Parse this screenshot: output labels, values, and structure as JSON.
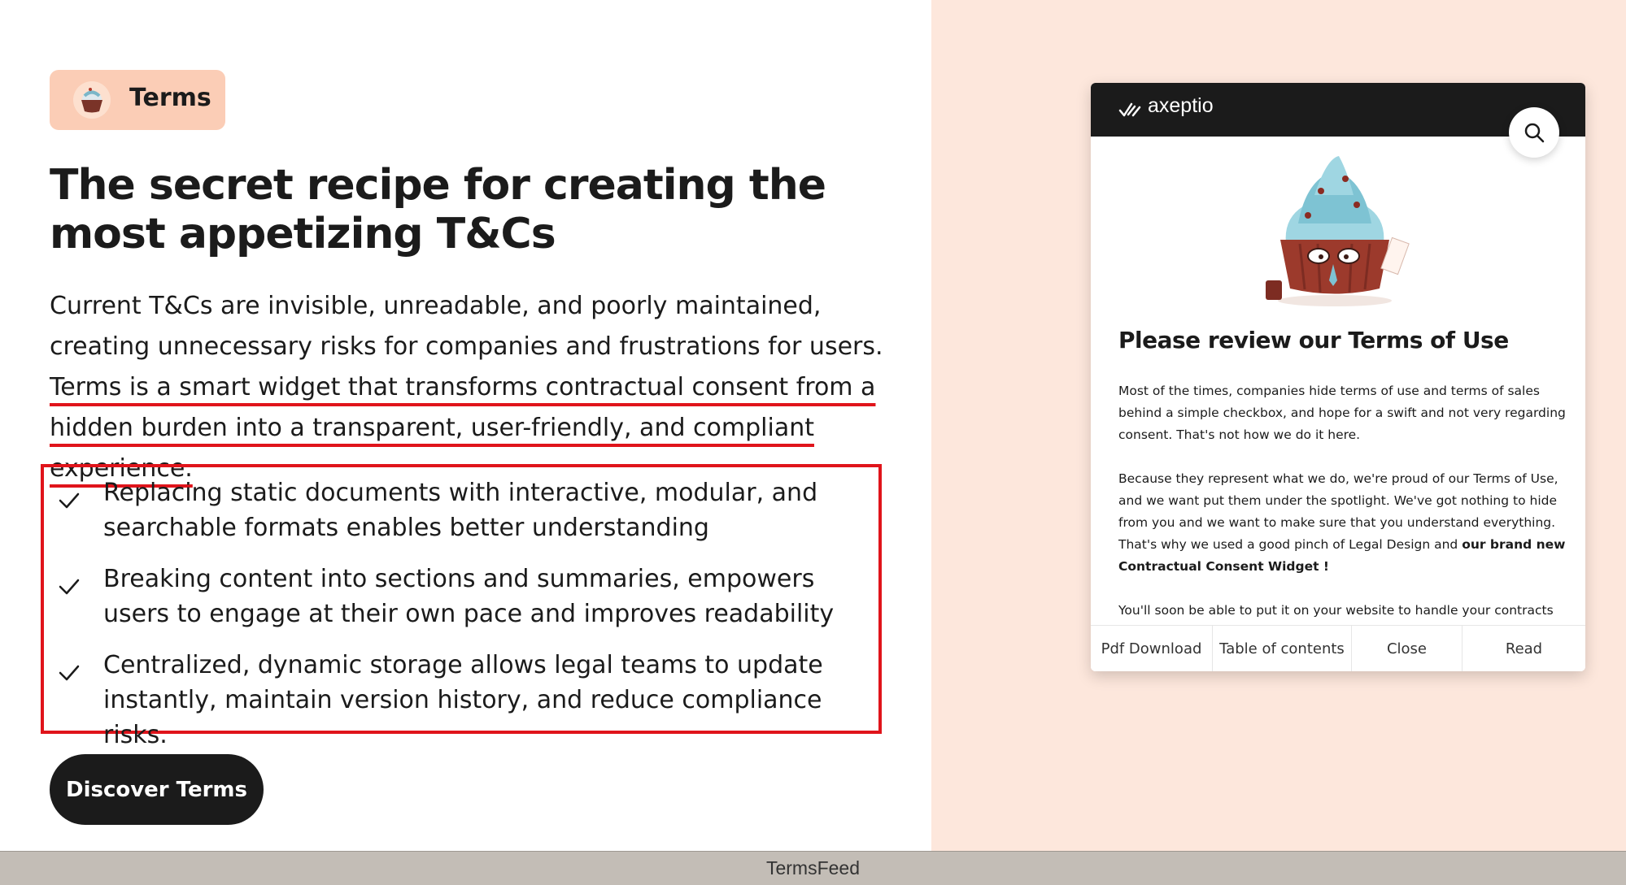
{
  "badge": {
    "label": "Terms",
    "icon": "cupcake-icon"
  },
  "hero": {
    "headline": "The secret recipe for creating the most appetizing T&Cs",
    "intro_plain": "Current T&Cs are invisible, unreadable, and poorly maintained, creating unnecessary risks for companies and frustrations for users.",
    "intro_highlight": " Terms is a smart widget that transforms contractual consent from a hidden burden into a transparent, user-friendly, and compliant experience. "
  },
  "features": [
    {
      "icon": "checkmark-icon",
      "text": "Replacing static documents with interactive, modular, and searchable formats enables better understanding"
    },
    {
      "icon": "checkmark-icon",
      "text": "Breaking content into sections and summaries, empowers users to engage at their own pace and improves readability"
    },
    {
      "icon": "checkmark-icon",
      "text": "Centralized, dynamic storage allows legal teams to update instantly, maintain version history, and reduce compliance risks."
    }
  ],
  "cta": {
    "label": "Discover Terms"
  },
  "widget": {
    "brand": "axeptio",
    "search_icon": "search-icon",
    "title": "Please review our Terms of Use",
    "paragraph1": "Most of the times, companies hide terms of use and terms of sales behind a simple checkbox, and hope for a swift and not very regarding consent. That's not how we do it here.",
    "paragraph2_plain": "Because they represent what we do, we're proud of our Terms of Use, and we want put them under the spotlight. We've got nothing to hide from you and we want to make sure that you understand everything. That's why we used a good pinch of Legal Design and ",
    "paragraph2_bold": "our brand new Contractual Consent Widget !",
    "paragraph3": "You'll soon be able to put it on your website to handle your contracts or",
    "actions": [
      "Pdf Download",
      "Table of contents",
      "Close",
      "Read"
    ]
  },
  "footer": {
    "label": "TermsFeed"
  },
  "colors": {
    "accent_red": "#e0141b",
    "badge_bg": "#fbcdb6",
    "panel_bg": "#fde7dc",
    "dark": "#1b1b1b"
  }
}
